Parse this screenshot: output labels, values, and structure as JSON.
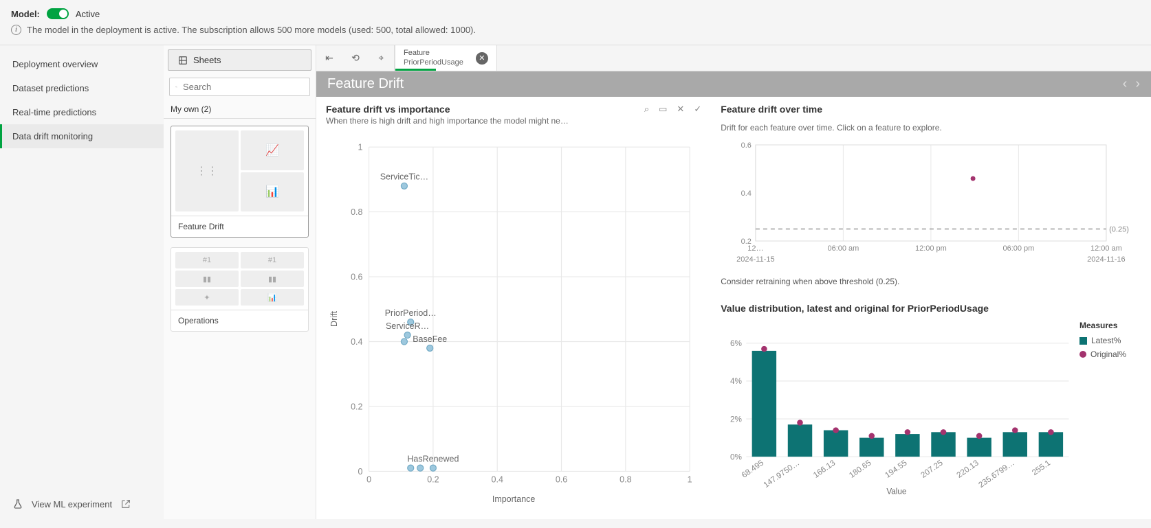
{
  "top": {
    "model_label": "Model:",
    "status": "Active",
    "info": "The model in the deployment is active. The subscription allows 500 more models (used: 500, total allowed: 1000)."
  },
  "nav": {
    "items": [
      "Deployment overview",
      "Dataset predictions",
      "Real-time predictions",
      "Data drift monitoring"
    ],
    "active_index": 3,
    "footer": "View ML experiment"
  },
  "sheets": {
    "button": "Sheets",
    "search_placeholder": "Search",
    "tab": "My own (2)",
    "cards": [
      {
        "label": "Feature Drift",
        "active": true
      },
      {
        "label": "Operations",
        "active": false
      }
    ]
  },
  "feature_tab": {
    "label": "Feature",
    "value": "PriorPeriodUsage"
  },
  "title": "Feature Drift",
  "chart_data": [
    {
      "type": "scatter",
      "title": "Feature drift vs importance",
      "subtitle": "When there is high drift and high importance the model might ne…",
      "xlabel": "Importance",
      "ylabel": "Drift",
      "xlim": [
        0,
        1
      ],
      "ylim": [
        0,
        1
      ],
      "points": [
        {
          "label": "ServiceTic…",
          "x": 0.11,
          "y": 0.88
        },
        {
          "label": "PriorPeriod…",
          "x": 0.13,
          "y": 0.46
        },
        {
          "label": "ServiceR…",
          "x": 0.12,
          "y": 0.42
        },
        {
          "label": "",
          "x": 0.11,
          "y": 0.4
        },
        {
          "label": "BaseFee",
          "x": 0.19,
          "y": 0.38
        },
        {
          "label": "HasRenewed",
          "x": 0.2,
          "y": 0.01
        },
        {
          "label": "",
          "x": 0.13,
          "y": 0.01
        },
        {
          "label": "",
          "x": 0.16,
          "y": 0.01
        }
      ]
    },
    {
      "type": "scatter-time",
      "title": "Feature drift over time",
      "subtitle": "Drift for each feature over time. Click on a feature to explore.",
      "ylim": [
        0.2,
        0.6
      ],
      "threshold": 0.25,
      "threshold_label": "(0.25)",
      "xticks": [
        "12…",
        "06:00 am",
        "12:00 pm",
        "06:00 pm",
        "12:00 am"
      ],
      "xdates": [
        "2024-11-15",
        "",
        "",
        "",
        "2024-11-16"
      ],
      "points": [
        {
          "x": 0.62,
          "y": 0.46
        }
      ],
      "note": "Consider retraining when above threshold (0.25)."
    },
    {
      "type": "bar",
      "title": "Value distribution, latest and original for PriorPeriodUsage",
      "xlabel": "Value",
      "ylabel": "",
      "ylim": [
        0,
        6
      ],
      "yticks": [
        "0%",
        "2%",
        "4%",
        "6%"
      ],
      "categories": [
        "68.495",
        "147.9750…",
        "166.13",
        "180.65",
        "194.55",
        "207.25",
        "220.13",
        "235.6799…",
        "255.1"
      ],
      "series": [
        {
          "name": "Latest%",
          "type": "bar",
          "values": [
            5.6,
            1.7,
            1.4,
            1.0,
            1.2,
            1.3,
            1.0,
            1.3,
            1.3
          ]
        },
        {
          "name": "Original%",
          "type": "dot",
          "values": [
            5.7,
            1.8,
            1.4,
            1.1,
            1.3,
            1.3,
            1.1,
            1.4,
            1.3
          ]
        }
      ],
      "legend_title": "Measures"
    }
  ]
}
